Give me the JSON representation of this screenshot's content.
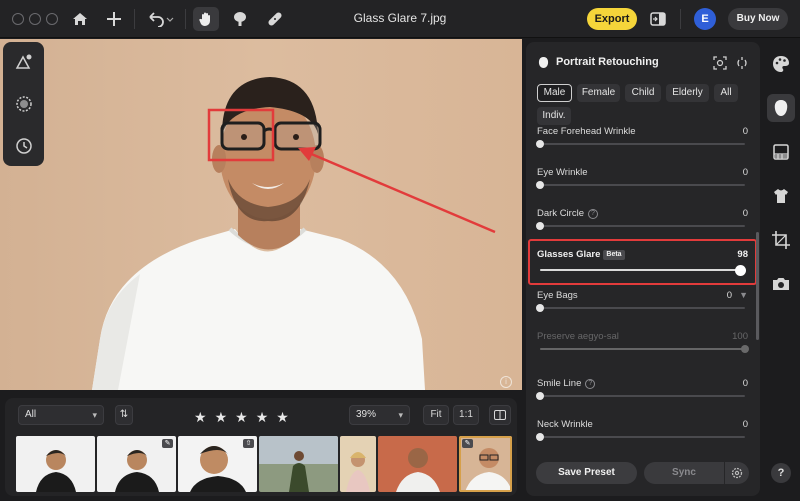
{
  "window": {
    "title": "Glass Glare 7.jpg"
  },
  "toolbar": {
    "export_label": "Export",
    "avatar_initial": "E",
    "buy_label": "Buy Now",
    "icons": [
      "home-icon",
      "plus-icon",
      "undo-icon",
      "hand-icon",
      "stamp-icon",
      "bandage-icon",
      "compare-panel-icon"
    ]
  },
  "canvas": {
    "left_tools": [
      "triangle-mask-icon",
      "dotted-circle-icon",
      "history-icon"
    ]
  },
  "filmstrip": {
    "filter": "All",
    "zoom": "39%",
    "fit_label": "Fit",
    "actual_label": "1:1",
    "rating_stars": 5
  },
  "panel": {
    "title": "Portrait Retouching",
    "chips": [
      {
        "label": "Male",
        "active": true
      },
      {
        "label": "Female",
        "active": false
      },
      {
        "label": "Child",
        "active": false
      },
      {
        "label": "Elderly",
        "active": false
      },
      {
        "label": "All",
        "active": false
      },
      {
        "label": "Indiv.",
        "active": false
      }
    ],
    "sliders": [
      {
        "label": "Face Forehead Wrinkle",
        "value": "0",
        "fraction": 0.0
      },
      {
        "label": "Eye Wrinkle",
        "value": "0",
        "fraction": 0.0
      },
      {
        "label": "Dark Circle",
        "value": "0",
        "fraction": 0.0
      },
      {
        "label": "Glasses Glare",
        "badge": "Beta",
        "value": "98",
        "fraction": 0.98
      },
      {
        "label": "Eye Bags",
        "value": "0",
        "fraction": 0.0
      },
      {
        "label": "Preserve aegyo-sal",
        "value": "100",
        "fraction": 1.0
      },
      {
        "label": "Smile Line",
        "value": "0",
        "fraction": 0.0
      },
      {
        "label": "Neck Wrinkle",
        "value": "0",
        "fraction": 0.0
      }
    ],
    "save_preset_label": "Save Preset",
    "sync_label": "Sync"
  },
  "right_tools": [
    "palette-icon",
    "face-icon",
    "grid-icon",
    "shirt-icon",
    "crop-icon",
    "camera-icon"
  ],
  "help_label": "?",
  "colors": {
    "accent_yellow": "#f5d53a",
    "highlight_red": "#e23b3b",
    "avatar_blue": "#2f5fd8"
  }
}
